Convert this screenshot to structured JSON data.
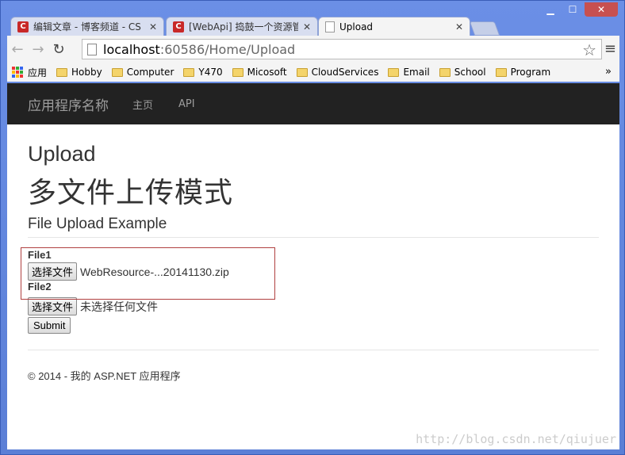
{
  "tabs": [
    {
      "label": "编辑文章 - 博客频道 - CS",
      "icon": "csdn-icon"
    },
    {
      "label": "[WebApi] 捣鼓一个资源管",
      "icon": "csdn-icon"
    },
    {
      "label": "Upload",
      "icon": "page-icon"
    }
  ],
  "address": {
    "host": "localhost",
    "path": ":60586/Home/Upload"
  },
  "bookmarks": [
    "应用",
    "Hobby",
    "Computer",
    "Y470",
    "Micosoft",
    "CloudServices",
    "Email",
    "School",
    "Program"
  ],
  "bookmarks_more": "»",
  "navbar": {
    "brand": "应用程序名称",
    "links": [
      "主页",
      "API"
    ]
  },
  "page": {
    "title": "Upload",
    "heading_cn": "多文件上传模式",
    "subheading": "File Upload Example",
    "file1": {
      "label": "File1",
      "button": "选择文件",
      "value": "WebResource-...20141130.zip"
    },
    "file2": {
      "label": "File2",
      "button": "选择文件",
      "value": "未选择任何文件"
    },
    "submit": "Submit",
    "footer": "© 2014 - 我的 ASP.NET 应用程序"
  },
  "watermark": "http://blog.csdn.net/qiujuer"
}
